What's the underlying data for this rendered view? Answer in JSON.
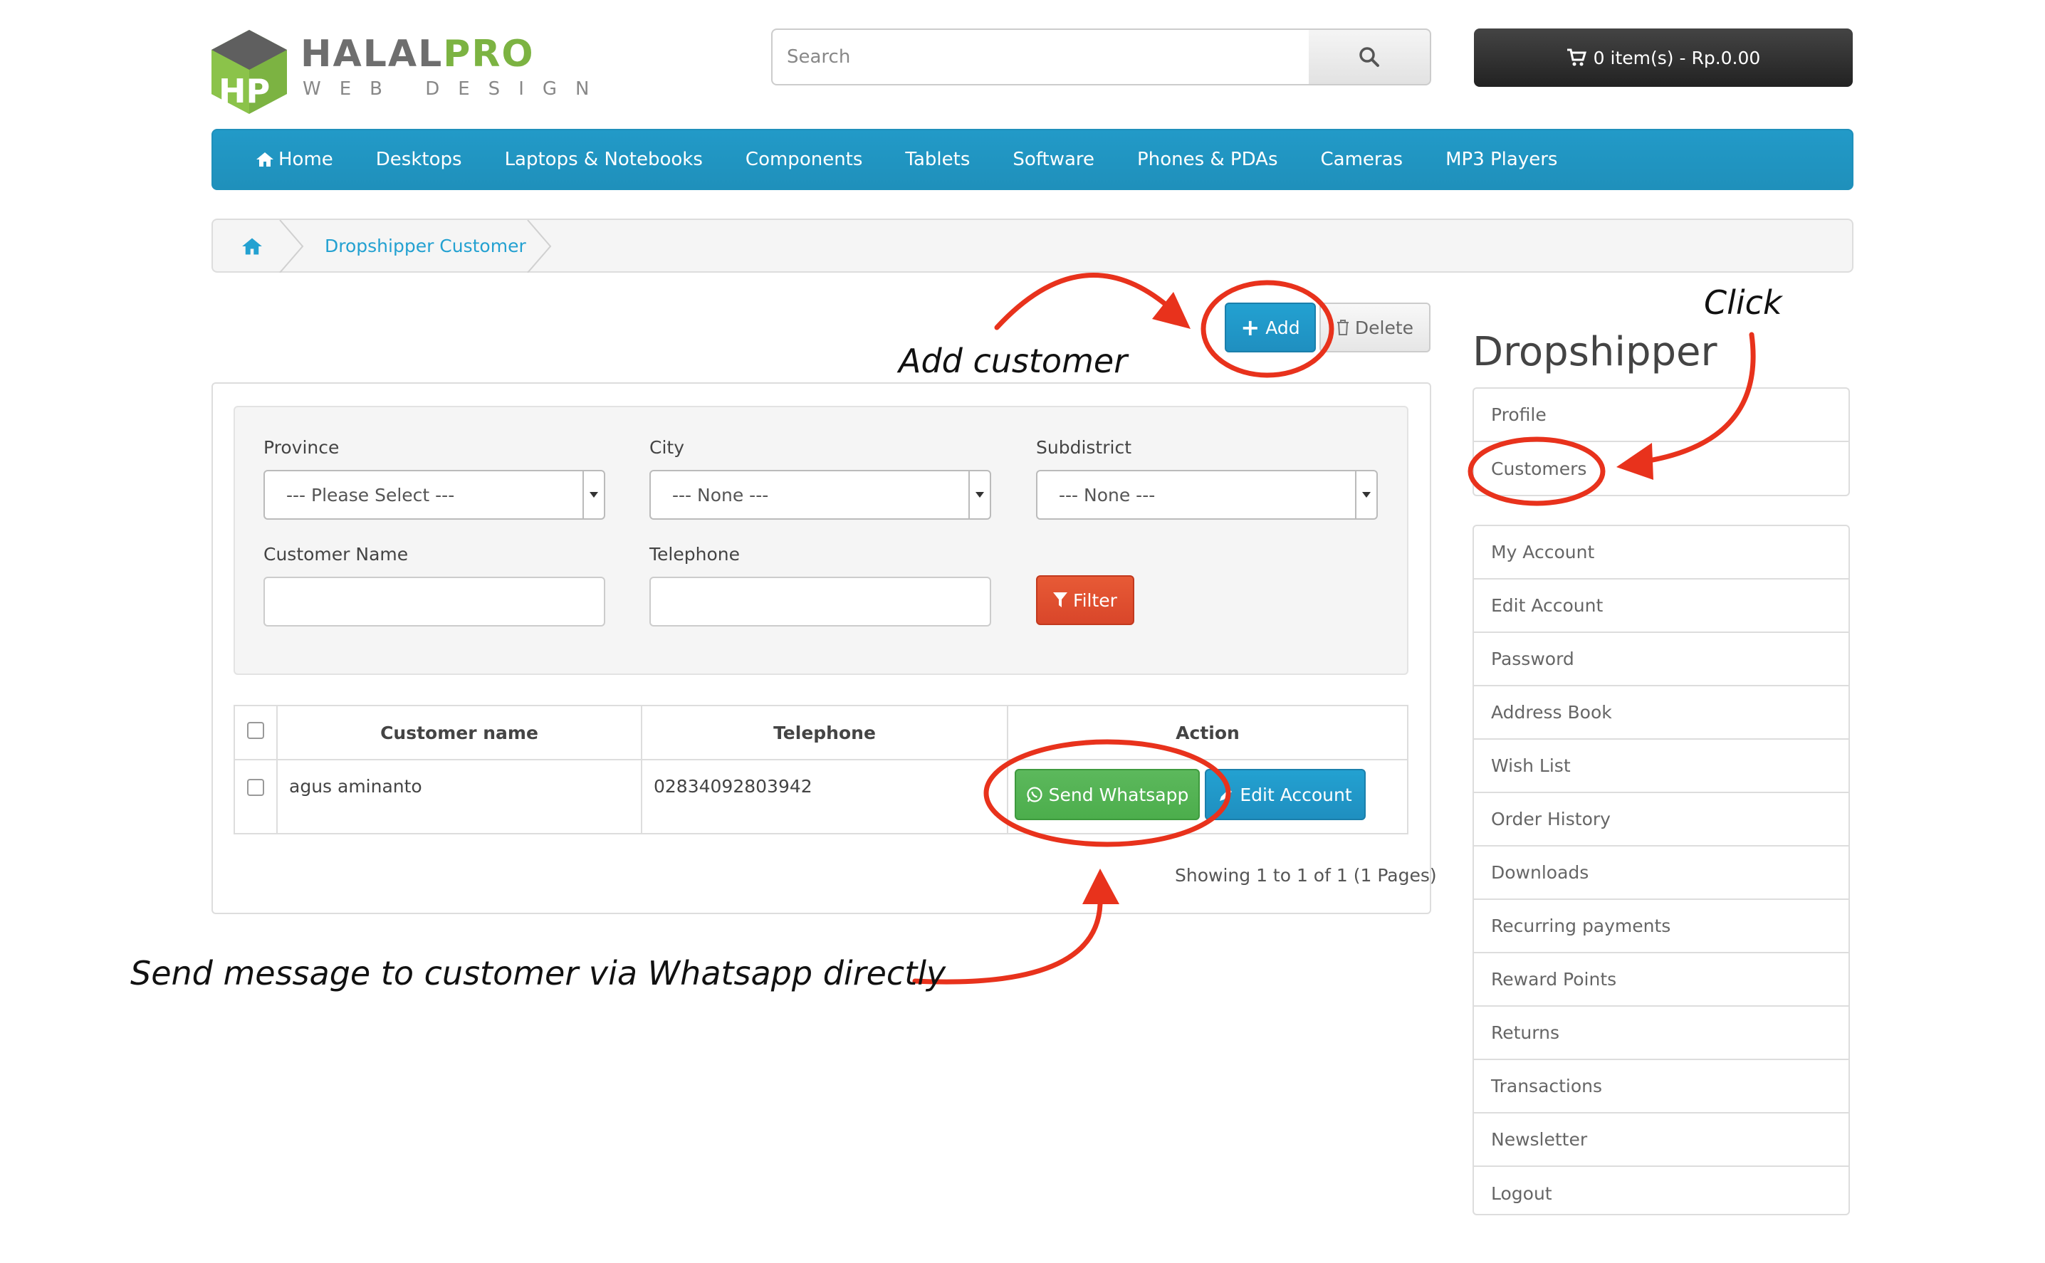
{
  "brand": {
    "name_part1": "HALAL",
    "name_part2": "PRO",
    "tagline": "WEB DESIGN"
  },
  "search": {
    "placeholder": "Search"
  },
  "cart": {
    "label": "0 item(s) - Rp.0.00"
  },
  "menu": [
    "Home",
    "Desktops",
    "Laptops & Notebooks",
    "Components",
    "Tablets",
    "Software",
    "Phones & PDAs",
    "Cameras",
    "MP3 Players"
  ],
  "breadcrumb": {
    "current": "Dropshipper Customer"
  },
  "actions": {
    "add": "Add",
    "delete": "Delete"
  },
  "filter": {
    "province_label": "Province",
    "province_value": "--- Please Select ---",
    "city_label": "City",
    "city_value": "--- None ---",
    "subdistrict_label": "Subdistrict",
    "subdistrict_value": "--- None ---",
    "customer_name_label": "Customer Name",
    "customer_name_value": "",
    "telephone_label": "Telephone",
    "telephone_value": "",
    "filter_button": "Filter"
  },
  "table": {
    "headers": [
      "Customer name",
      "Telephone",
      "Action"
    ],
    "rows": [
      {
        "name": "agus aminanto",
        "telephone": "02834092803942",
        "whatsapp": "Send Whatsapp",
        "edit": "Edit Account"
      }
    ]
  },
  "pagination": "Showing 1 to 1 of 1 (1 Pages)",
  "sidebar": {
    "title": "Dropshipper",
    "group1": [
      "Profile",
      "Customers"
    ],
    "group2": [
      "My Account",
      "Edit Account",
      "Password",
      "Address Book",
      "Wish List",
      "Order History",
      "Downloads",
      "Recurring payments",
      "Reward Points",
      "Returns",
      "Transactions",
      "Newsletter",
      "Logout"
    ]
  },
  "annotations": {
    "add_customer": "Add customer",
    "click": "Click",
    "send_message": "Send message to customer via Whatsapp directly"
  },
  "colors": {
    "primary": "#229ac8",
    "annotation": "#e8321c",
    "whatsapp": "#5cb85c",
    "filter": "#e75a36",
    "logo_green": "#7cb342"
  }
}
